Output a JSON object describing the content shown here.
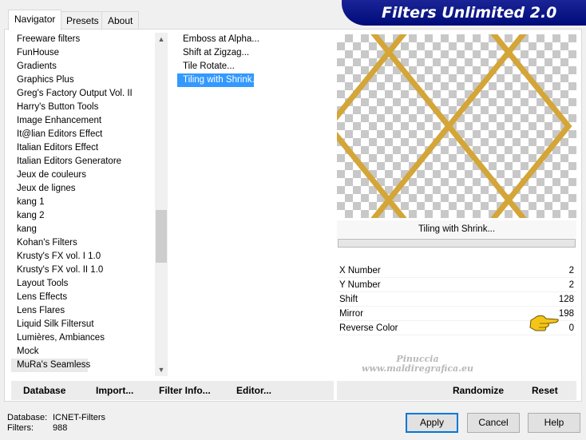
{
  "tabs": [
    {
      "label": "Navigator"
    },
    {
      "label": "Presets"
    },
    {
      "label": "About"
    }
  ],
  "banner": {
    "title": "Filters Unlimited 2.0"
  },
  "categories": [
    "Freeware filters",
    "FunHouse",
    "Gradients",
    "Graphics Plus",
    "Greg's Factory Output Vol. II",
    "Harry's Button Tools",
    "Image Enhancement",
    "It@lian Editors Effect",
    "Italian Editors Effect",
    "Italian Editors Generatore",
    "Jeux de couleurs",
    "Jeux de lignes",
    "kang 1",
    "kang 2",
    "kang",
    "Kohan's Filters",
    "Krusty's FX vol. I 1.0",
    "Krusty's FX vol. II 1.0",
    "Layout Tools",
    "Lens Effects",
    "Lens Flares",
    "Liquid Silk Filtersut",
    "Lumières, Ambiances",
    "Mock",
    "MuRa's Seamless"
  ],
  "filters": [
    "Emboss at Alpha...",
    "Shift at Zigzag...",
    "Tile Rotate...",
    "Tiling with Shrink..."
  ],
  "preview": {
    "filter_name": "Tiling with Shrink...",
    "line_color": "#d4a537"
  },
  "params": [
    {
      "name": "X Number",
      "value": "2"
    },
    {
      "name": "Y Number",
      "value": "2"
    },
    {
      "name": "Shift",
      "value": "128"
    },
    {
      "name": "Mirror",
      "value": "198"
    },
    {
      "name": "Reverse Color",
      "value": "0"
    }
  ],
  "watermark": {
    "line1": "Pinuccia",
    "line2": "www.maldiregrafica.eu"
  },
  "left_bar": {
    "database": "Database",
    "import": "Import...",
    "filter_info": "Filter Info...",
    "editor": "Editor..."
  },
  "right_bar": {
    "randomize": "Randomize",
    "reset": "Reset"
  },
  "status": {
    "database_label": "Database:",
    "database_value": "ICNET-Filters",
    "filters_label": "Filters:",
    "filters_value": "988"
  },
  "buttons": {
    "apply": "Apply",
    "cancel": "Cancel",
    "help": "Help"
  }
}
